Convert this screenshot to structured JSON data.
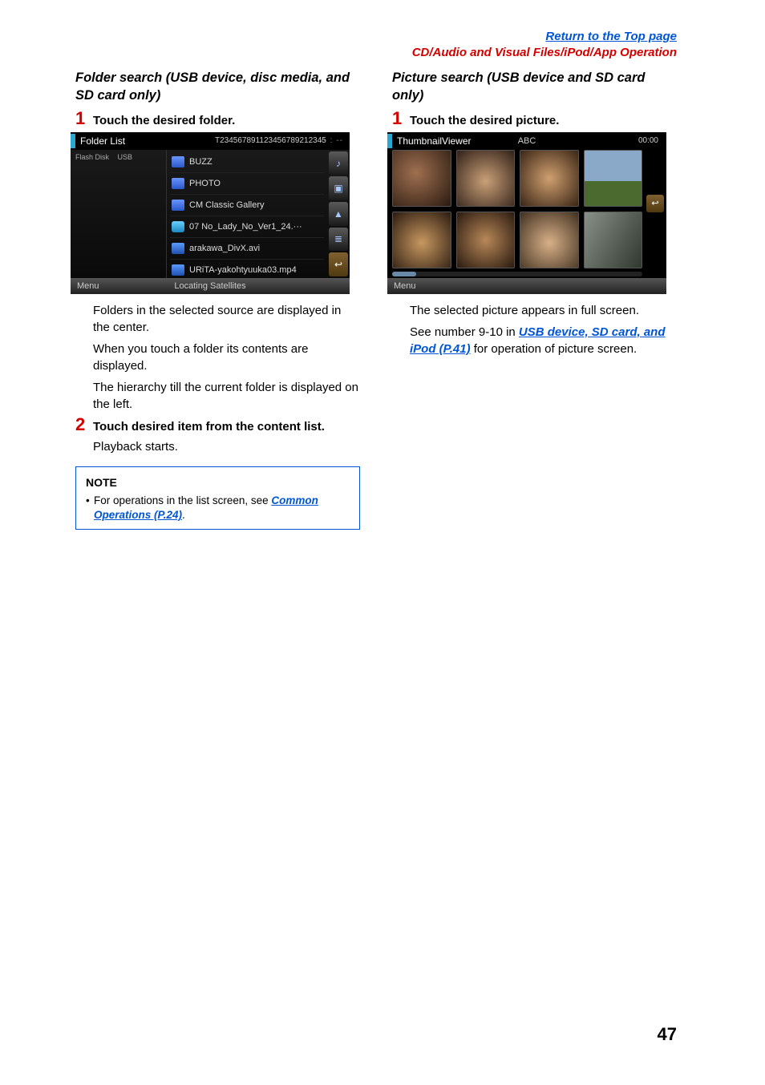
{
  "header": {
    "top_link": "Return to the Top page",
    "section": "CD/Audio and Visual Files/iPod/App Operation"
  },
  "left": {
    "heading": "Folder search (USB device, disc media, and SD card only)",
    "step1": {
      "num": "1",
      "text": "Touch the desired folder."
    },
    "shot": {
      "title_left": "Folder List",
      "title_mid": "T234567891123456789212345",
      "title_right": "-- : --",
      "left_crumb1": "Flash Disk",
      "left_crumb2": "USB",
      "rows": [
        {
          "label": "BUZZ"
        },
        {
          "label": "PHOTO"
        },
        {
          "label": "CM Classic Gallery"
        },
        {
          "label": "07 No_Lady_No_Ver1_24.···"
        },
        {
          "label": "arakawa_DivX.avi"
        },
        {
          "label": "URiTA-yakohtyuuka03.mp4"
        }
      ],
      "menu": "Menu",
      "status": "Locating Satellites"
    },
    "body1": "Folders in the selected source are displayed in the center.",
    "body2": "When you touch a folder its contents are displayed.",
    "body3": "The hierarchy till the current folder is displayed on the left.",
    "step2": {
      "num": "2",
      "text": "Touch desired item from the content list."
    },
    "body4": "Playback starts.",
    "note": {
      "title": "NOTE",
      "line_before": "For operations in the list screen, see ",
      "link": "Common Operations (P.24)",
      "after": "."
    }
  },
  "right": {
    "heading": "Picture search (USB device and SD card only)",
    "step1": {
      "num": "1",
      "text": "Touch the desired picture."
    },
    "shot": {
      "title_left": "ThumbnailViewer",
      "title_mid": "ABC",
      "title_right": "00:00",
      "menu": "Menu"
    },
    "body1": "The selected picture appears in full screen.",
    "body2_before": "See number 9-10 in ",
    "body2_link": "USB device, SD card, and iPod (P.41)",
    "body2_after": " for operation of picture screen."
  },
  "page_number": "47"
}
